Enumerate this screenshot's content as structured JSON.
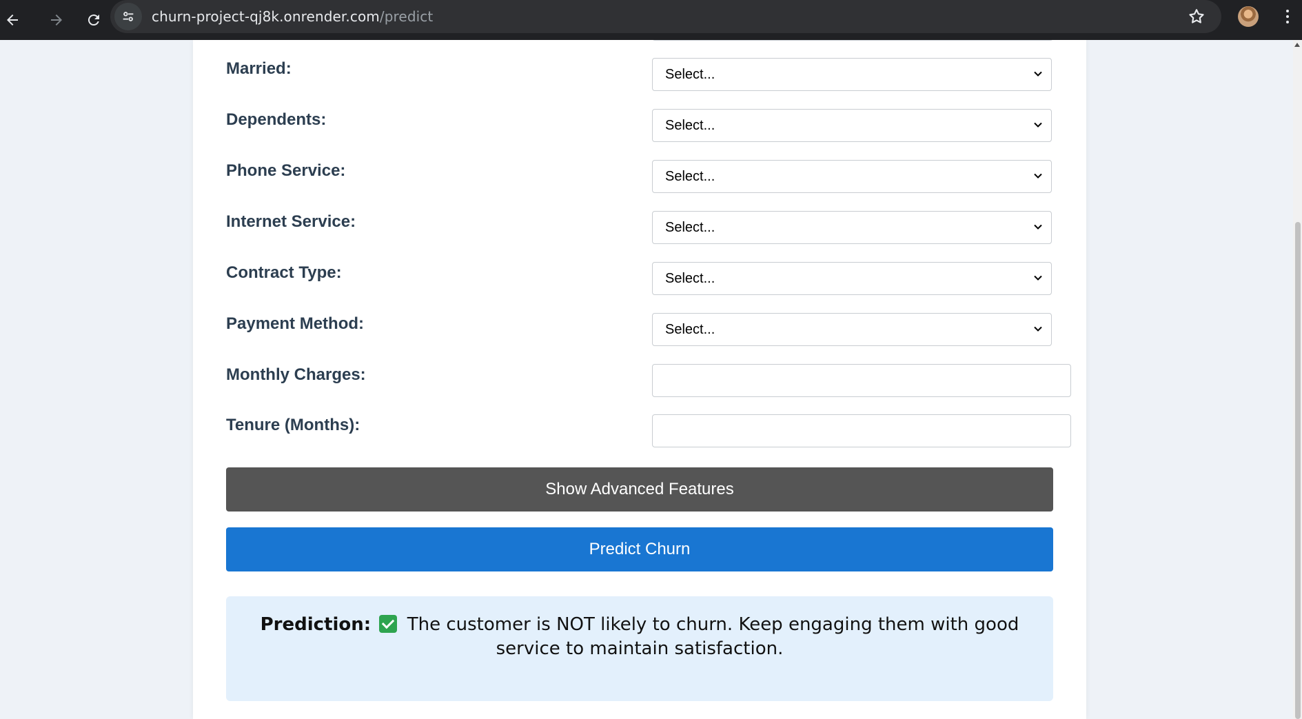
{
  "browser": {
    "url_host": "churn-project-qj8k.onrender.com",
    "url_path": "/predict"
  },
  "form": {
    "fields": [
      {
        "label": "Married:",
        "value": "Select..."
      },
      {
        "label": "Dependents:",
        "value": "Select..."
      },
      {
        "label": "Phone Service:",
        "value": "Select..."
      },
      {
        "label": "Internet Service:",
        "value": "Select..."
      },
      {
        "label": "Contract Type:",
        "value": "Select..."
      },
      {
        "label": "Payment Method:",
        "value": "Select..."
      }
    ],
    "inputs": [
      {
        "label": "Monthly Charges:",
        "value": ""
      },
      {
        "label": "Tenure (Months):",
        "value": ""
      }
    ],
    "advanced_button": "Show Advanced Features",
    "predict_button": "Predict Churn"
  },
  "result": {
    "label": "Prediction:",
    "message": "The customer is NOT likely to churn. Keep engaging them with good service to maintain satisfaction."
  },
  "colors": {
    "predict_button": "#1976d2",
    "advanced_button": "#555555",
    "result_background": "#e3f0fc"
  }
}
